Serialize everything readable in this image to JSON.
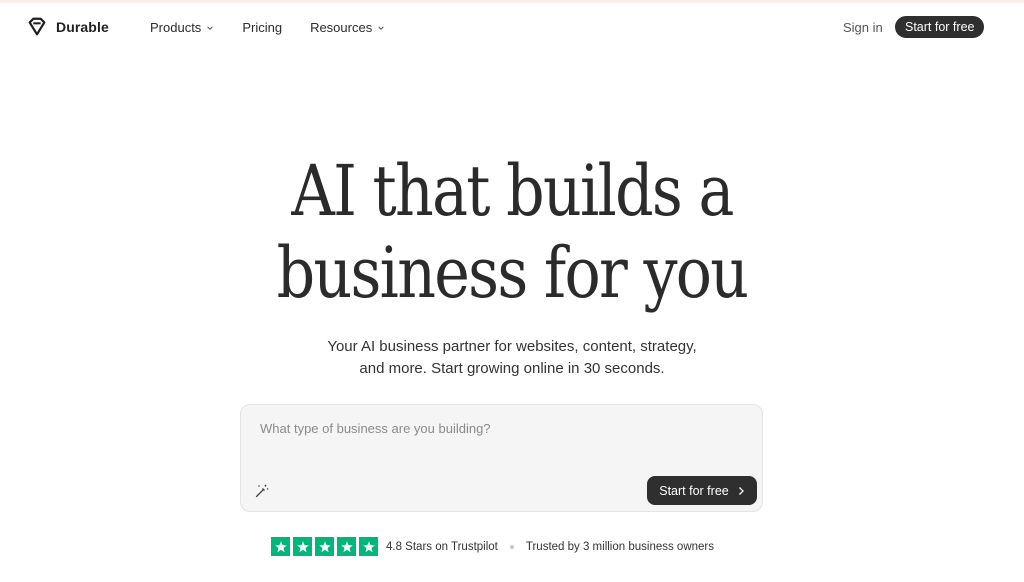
{
  "nav": {
    "brand": "Durable",
    "items": [
      {
        "label": "Products",
        "has_dropdown": true
      },
      {
        "label": "Pricing",
        "has_dropdown": false
      },
      {
        "label": "Resources",
        "has_dropdown": true
      }
    ],
    "sign_in": "Sign in",
    "cta": "Start for free"
  },
  "hero": {
    "line1": "AI that builds a",
    "line2": "business for you",
    "sub_line1": "Your AI business partner for websites, content, strategy,",
    "sub_line2": "and more. Start growing online in 30 seconds."
  },
  "prompt": {
    "placeholder": "What type of business are you building?",
    "value": "",
    "submit_label": "Start for free",
    "wand_icon": "magic-wand-icon",
    "submit_icon": "chevron-right-icon"
  },
  "trust": {
    "stars": 5,
    "rating_text": "4.8 Stars on Trustpilot",
    "trusted_text": "Trusted by 3 million business owners",
    "star_color": "#00b67a"
  },
  "colors": {
    "primary_dark": "#2f2f2f",
    "top_stripe": "#fbeee6"
  }
}
